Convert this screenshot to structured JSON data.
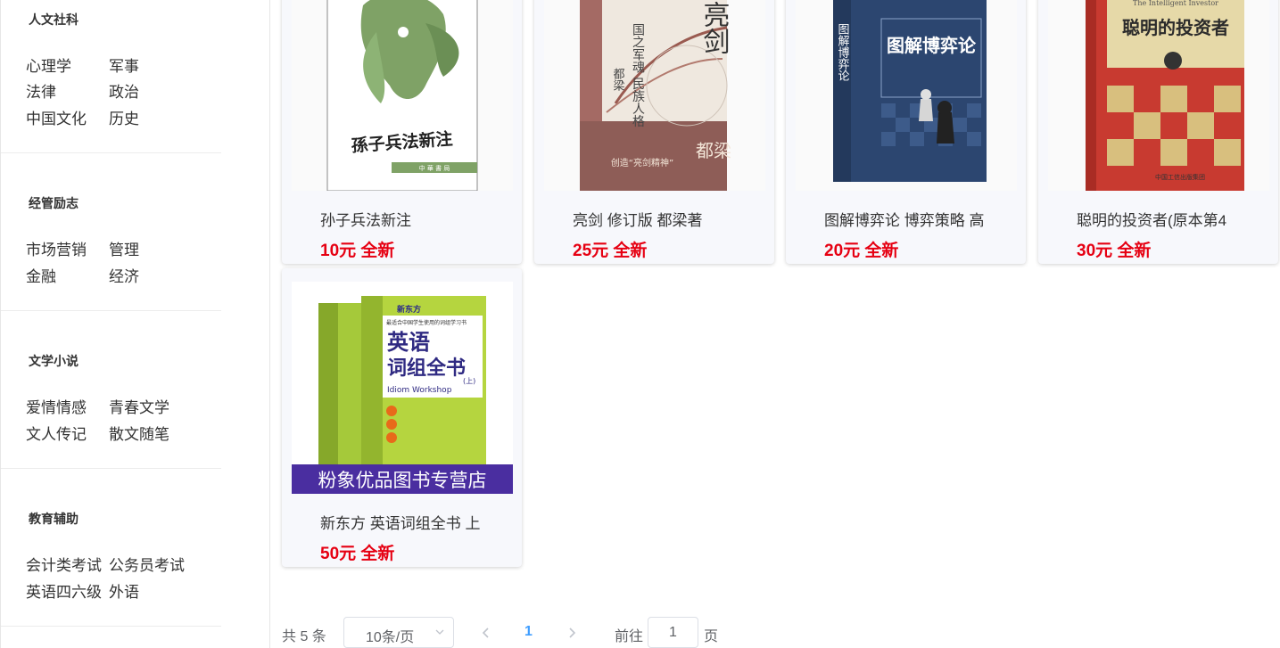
{
  "sidebar": {
    "sections": [
      {
        "title": "人文社科",
        "items": [
          "心理学",
          "军事",
          "法律",
          "政治",
          "中国文化",
          "历史"
        ]
      },
      {
        "title": "经管励志",
        "items": [
          "市场营销",
          "管理",
          "金融",
          "经济"
        ]
      },
      {
        "title": "文学小说",
        "items": [
          "爱情情感",
          "青春文学",
          "文人传记",
          "散文随笔"
        ]
      },
      {
        "title": "教育辅助",
        "items": [
          "会计类考试",
          "公务员考试",
          "英语四六级",
          "外语"
        ]
      }
    ]
  },
  "products": [
    {
      "title": "孙子兵法新注",
      "price": "10元 全新",
      "cover": {
        "calligraphy": "孫子兵法新注",
        "publisher": "中 華 書 局"
      }
    },
    {
      "title": "亮剑 修订版 都梁著",
      "price": "25元 全新",
      "cover": {
        "title": "亮剑",
        "author": "都梁",
        "vertical_text": "国之军魂 民族人格",
        "slogan": "创造“亮剑精神”"
      }
    },
    {
      "title": "图解博弈论 博弈策略 高",
      "price": "20元 全新",
      "cover": {
        "title": "图解博弈论",
        "spine": "图解博弈论"
      }
    },
    {
      "title": "聪明的投资者(原本第4",
      "price": "30元 全新",
      "cover": {
        "title": "聪明的投资者",
        "en_title": "The Intelligent Investor",
        "publisher": "中国工信出版集团"
      }
    },
    {
      "title": "新东方 英语词组全书 上",
      "price": "50元 全新",
      "cover": {
        "brand": "新东方",
        "tagline": "最适合中国学生使用的词组学习书",
        "title_line1": "英语",
        "title_line2": "词组全书",
        "volume": "(上)",
        "en_title": "Idiom Workshop",
        "banner": "粉象优品图书专营店"
      }
    }
  ],
  "pagination": {
    "total": "共 5 条",
    "page_size": "10条/页",
    "current_page": "1",
    "goto_label": "前往",
    "goto_value": "1",
    "page_suffix": "页"
  },
  "colors": {
    "price": "#e60012",
    "active_page": "#409eff",
    "card_bg": "#f7f8fc"
  }
}
